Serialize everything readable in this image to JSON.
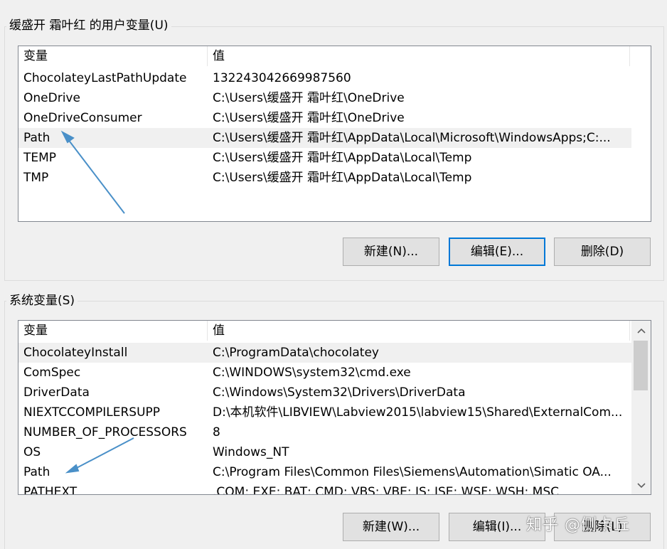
{
  "user_vars": {
    "title": "缓盛开 霜叶红 的用户变量(U)",
    "col_name": "变量",
    "col_value": "值",
    "rows": [
      {
        "name": "ChocolateyLastPathUpdate",
        "value": "132243042669987560"
      },
      {
        "name": "OneDrive",
        "value": "C:\\Users\\缓盛开 霜叶红\\OneDrive"
      },
      {
        "name": "OneDriveConsumer",
        "value": "C:\\Users\\缓盛开 霜叶红\\OneDrive"
      },
      {
        "name": "Path",
        "value": "C:\\Users\\缓盛开 霜叶红\\AppData\\Local\\Microsoft\\WindowsApps;C:..."
      },
      {
        "name": "TEMP",
        "value": "C:\\Users\\缓盛开 霜叶红\\AppData\\Local\\Temp"
      },
      {
        "name": "TMP",
        "value": "C:\\Users\\缓盛开 霜叶红\\AppData\\Local\\Temp"
      }
    ],
    "buttons": {
      "new": "新建(N)...",
      "edit": "编辑(E)...",
      "delete": "删除(D)"
    }
  },
  "system_vars": {
    "title": "系统变量(S)",
    "col_name": "变量",
    "col_value": "值",
    "rows": [
      {
        "name": "ChocolateyInstall",
        "value": "C:\\ProgramData\\chocolatey"
      },
      {
        "name": "ComSpec",
        "value": "C:\\WINDOWS\\system32\\cmd.exe"
      },
      {
        "name": "DriverData",
        "value": "C:\\Windows\\System32\\Drivers\\DriverData"
      },
      {
        "name": "NIEXTCCOMPILERSUPP",
        "value": "D:\\本机软件\\LIBVIEW\\Labview2015\\labview15\\Shared\\ExternalCom..."
      },
      {
        "name": "NUMBER_OF_PROCESSORS",
        "value": "8"
      },
      {
        "name": "OS",
        "value": "Windows_NT"
      },
      {
        "name": "Path",
        "value": "C:\\Program Files\\Common Files\\Siemens\\Automation\\Simatic OA..."
      },
      {
        "name": "PATHEXT",
        "value": ".COM;.EXE;.BAT;.CMD;.VBS;.VBE;.JS;.JSE;.WSF;.WSH;.MSC"
      }
    ],
    "buttons": {
      "new": "新建(W)...",
      "edit": "编辑(I)...",
      "delete": "删除(L)"
    }
  },
  "watermark": "知乎 @侧卡丘",
  "colors": {
    "accent": "#0078d7",
    "annotation_arrow": "#4a90c8"
  }
}
